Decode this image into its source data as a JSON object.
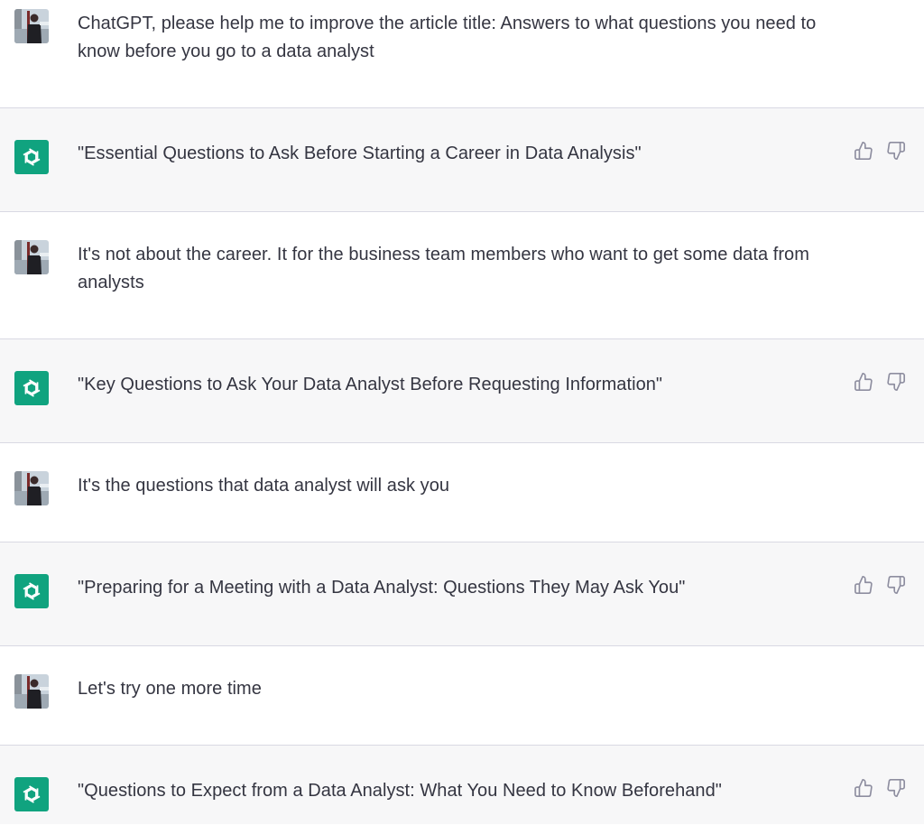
{
  "conversation": [
    {
      "role": "user",
      "text": "ChatGPT, please help me to improve the article title: Answers to what questions you need to know before you go to a data analyst"
    },
    {
      "role": "assistant",
      "text": "\"Essential Questions to Ask Before Starting a Career in Data Analysis\""
    },
    {
      "role": "user",
      "text": "It's not about the career. It for the business team members who want to get some data from analysts"
    },
    {
      "role": "assistant",
      "text": "\"Key Questions to Ask Your Data Analyst Before Requesting Information\""
    },
    {
      "role": "user",
      "text": "It's the questions that data analyst will ask you"
    },
    {
      "role": "assistant",
      "text": "\"Preparing for a Meeting with a Data Analyst: Questions They May Ask You\""
    },
    {
      "role": "user",
      "text": "Let's try one more time"
    },
    {
      "role": "assistant",
      "text": "\"Questions to Expect from a Data Analyst: What You Need to Know Beforehand\""
    }
  ],
  "icons": {
    "user_avatar": "user-photo-avatar",
    "assistant_avatar": "openai-logo-icon",
    "like": "thumbs-up-icon",
    "dislike": "thumbs-down-icon"
  },
  "colors": {
    "assistant_bg": "#f7f7f8",
    "user_bg": "#ffffff",
    "brand": "#10a37f",
    "text": "#343541",
    "divider": "#d9d9e3"
  }
}
